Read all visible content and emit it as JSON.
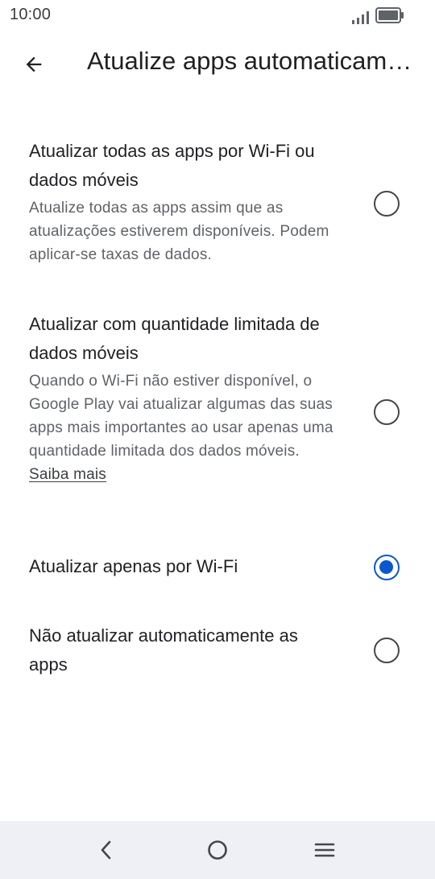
{
  "status_bar": {
    "time": "10:00",
    "icons": [
      "signal-icon",
      "battery-icon"
    ]
  },
  "app_bar": {
    "back_icon": "arrow-left-icon",
    "title": "Atualize apps automaticamente"
  },
  "options": [
    {
      "title": "Atualizar todas as apps por Wi-Fi ou dados móveis",
      "description": "Atualize todas as apps assim que as atualizações estiverem disponíveis. Podem aplicar-se taxas de dados.",
      "selected": false
    },
    {
      "title": "Atualizar com quantidade limitada de dados móveis",
      "description": "Quando o Wi-Fi não estiver disponível, o Google Play vai atualizar algumas das suas apps mais importantes ao usar apenas uma quantidade limitada dos dados móveis.",
      "link": "Saiba mais",
      "selected": false
    },
    {
      "title": "Atualizar apenas por Wi-Fi",
      "selected": true
    },
    {
      "title": "Não atualizar automaticamente as apps",
      "selected": false
    }
  ],
  "nav_bar": {
    "icons": [
      "back-triangle-icon",
      "home-circle-icon",
      "menu-lines-icon"
    ]
  },
  "colors": {
    "accent": "#0b57d0",
    "text_primary": "#202124",
    "text_secondary": "#5f6368",
    "nav_background": "#eef0f6"
  }
}
